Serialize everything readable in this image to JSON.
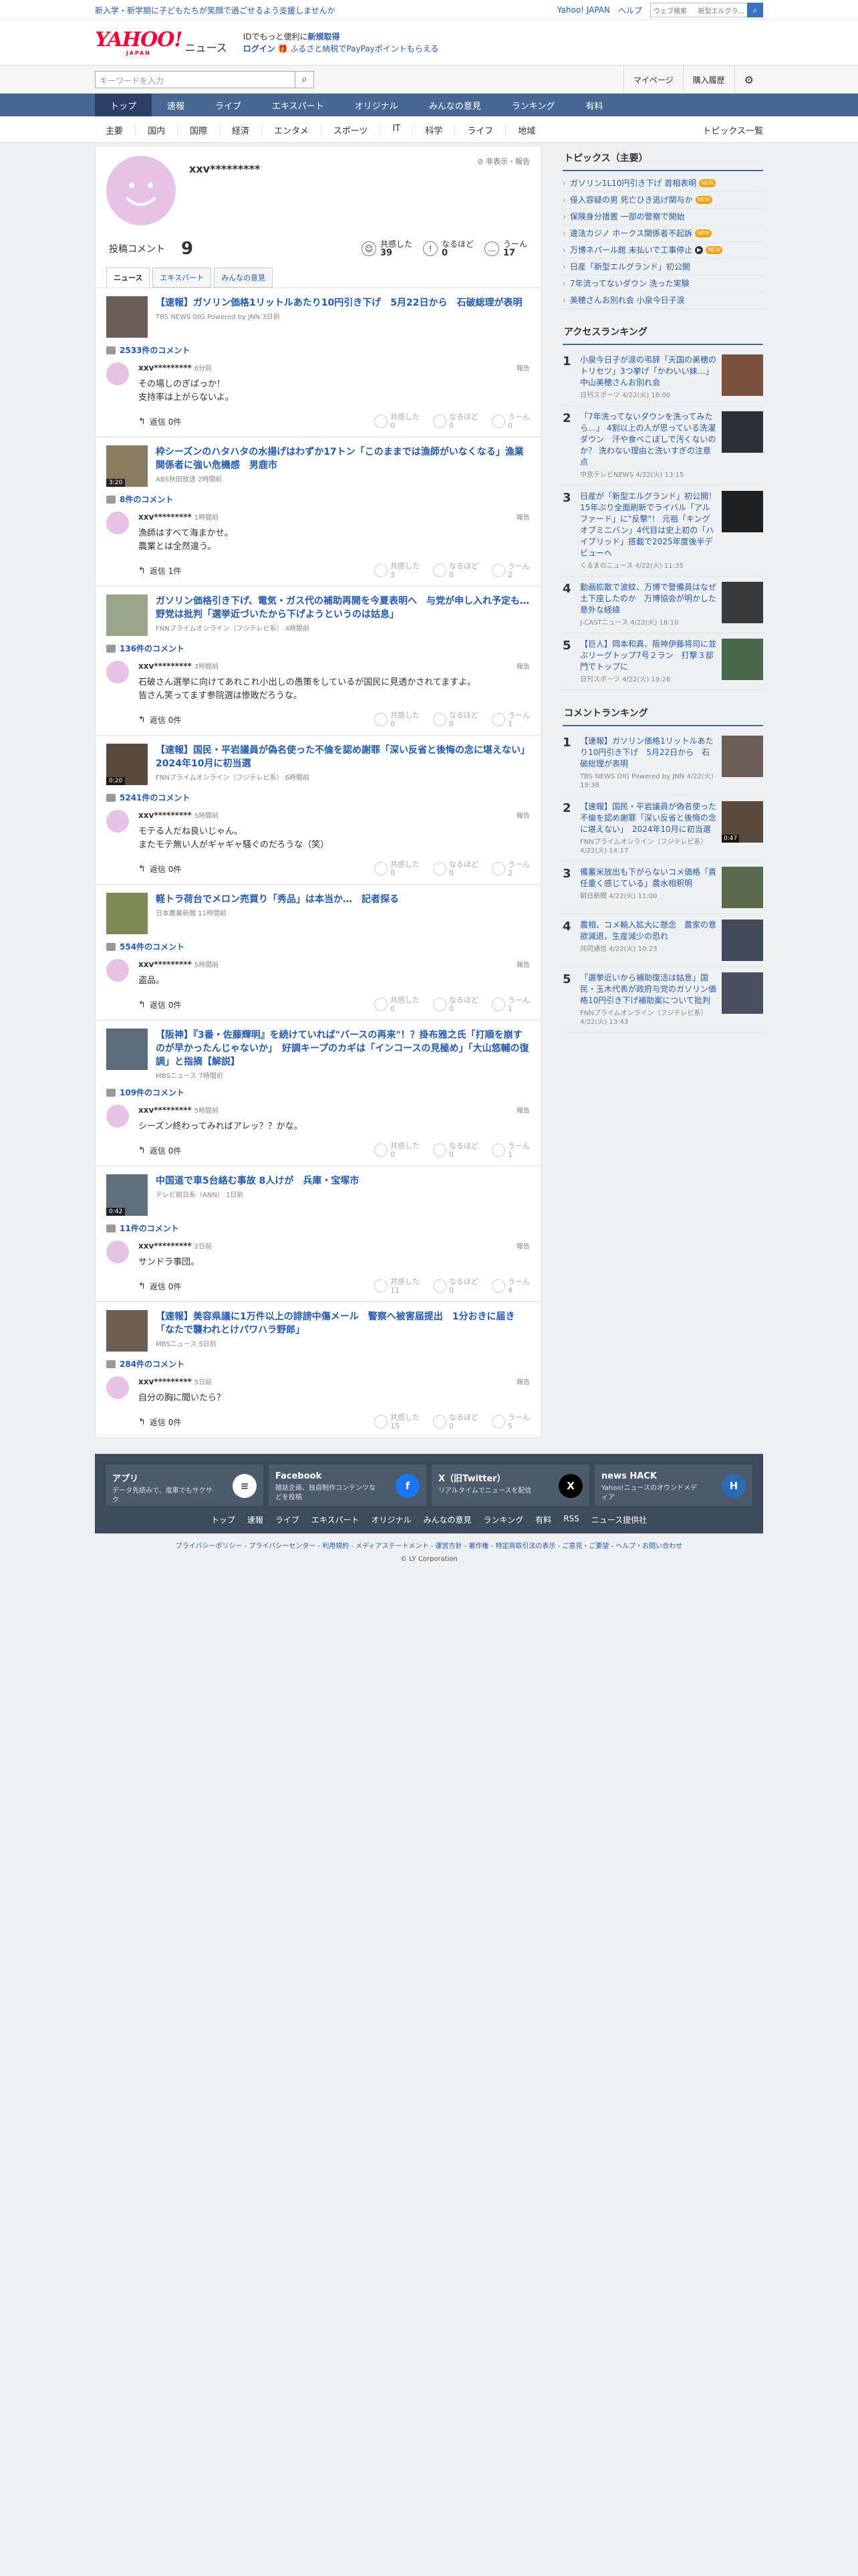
{
  "utility": {
    "promo": "新入学・新学期に子どもたちが笑顔で過ごせるよう支援しませんか",
    "links": [
      "Yahoo! JAPAN",
      "ヘルプ"
    ],
    "search_text": "ウェブ検索",
    "search_query": "新型エルグラ..."
  },
  "header": {
    "logo_text": "YAHOO!",
    "logo_sub": "JAPAN",
    "logo_service": "ニュース",
    "msg_line1_pre": "IDでもっと便利に",
    "msg_line1_link": "新規取得",
    "msg_line2_link": "ログイン",
    "msg_line2_text": "ふるさと納税でPayPayポイントもらえる"
  },
  "searchbar": {
    "placeholder": "キーワードを入力",
    "mypage": "マイページ",
    "history": "購入履歴"
  },
  "nav": {
    "tabs": [
      "トップ",
      "速報",
      "ライブ",
      "エキスパート",
      "オリジナル",
      "みんなの意見",
      "ランキング",
      "有料"
    ],
    "active_index": 0
  },
  "categories": {
    "items": [
      "主要",
      "国内",
      "国際",
      "経済",
      "エンタメ",
      "スポーツ",
      "IT",
      "科学",
      "ライフ",
      "地域"
    ],
    "all": "トピックス一覧"
  },
  "profile": {
    "name": "xxv*********",
    "report": "非表示・報告",
    "post_label": "投稿コメント",
    "post_count": "9",
    "reacts": [
      {
        "label": "共感した",
        "count": "39",
        "icon": "☺"
      },
      {
        "label": "なるほど",
        "count": "0",
        "icon": "!"
      },
      {
        "label": "うーん",
        "count": "17",
        "icon": "…"
      }
    ],
    "tabs": [
      "ニュース",
      "エキスパート",
      "みんなの意見"
    ]
  },
  "comments": [
    {
      "title": "【速報】ガソリン価格1リットルあたり10円引き下げ　5月22日から　石破総理が表明",
      "source": "TBS NEWS DIG Powered by JNN 3日前",
      "count": "2533件のコメント",
      "video": "",
      "thumb_color": "#6b5e57",
      "user": "xxv*********",
      "time": "6分前",
      "text": "その場しのぎばっか！\n支持率は上がらないよ。",
      "reply": "返信 0件",
      "reacts": [
        {
          "label": "共感した",
          "count": "0"
        },
        {
          "label": "なるほど",
          "count": "0"
        },
        {
          "label": "うーん",
          "count": "0"
        }
      ]
    },
    {
      "title": "枠シーズンのハタハタの水揚げはわずか17トン「このままでは漁師がいなくなる」漁業関係者に強い危機感　男鹿市",
      "source": "ABS秋田放送 2時間前",
      "count": "8件のコメント",
      "video": "3:20",
      "thumb_color": "#8a7b63",
      "user": "xxv*********",
      "time": "1時間前",
      "text": "漁師はすべて海まかせ。\n農業とは全然違う。",
      "reply": "返信 1件",
      "reacts": [
        {
          "label": "共感した",
          "count": "3"
        },
        {
          "label": "なるほど",
          "count": "0"
        },
        {
          "label": "うーん",
          "count": "2"
        }
      ]
    },
    {
      "title": "ガソリン価格引き下げ、電気・ガス代の補助再開を今夏表明へ　与党が申し入れ予定も…　野党は批判「選挙近づいたから下げようというのは姑息」",
      "source": "FNNプライムオンライン（フジテレビ系） 4時間前",
      "count": "136件のコメント",
      "video": "",
      "thumb_color": "#9aa58a",
      "user": "xxv*********",
      "time": "3時間前",
      "text": "石破さん選挙に向けてあれこれ小出しの愚策をしているが国民に見透かされてますよ。\n皆さん笑ってます参院選は惨敗だろうな。",
      "reply": "返信 0件",
      "reacts": [
        {
          "label": "共感した",
          "count": "0"
        },
        {
          "label": "なるほど",
          "count": "0"
        },
        {
          "label": "うーん",
          "count": "1"
        }
      ]
    },
    {
      "title": "【速報】国民・平岩議員が偽名使った不倫を認め謝罪「深い反省と後悔の念に堪えない」　2024年10月に初当選",
      "source": "FNNプライムオンライン（フジテレビ系） 6時間前",
      "count": "5241件のコメント",
      "video": "0:20",
      "thumb_color": "#5a4a3e",
      "user": "xxv*********",
      "time": "5時間前",
      "text": "モテる人だね良いじゃん。\nまたモテ無い人がギャギャ騒ぐのだろうな（笑）",
      "reply": "返信 0件",
      "reacts": [
        {
          "label": "共感した",
          "count": "0"
        },
        {
          "label": "なるほど",
          "count": "0"
        },
        {
          "label": "うーん",
          "count": "2"
        }
      ]
    },
    {
      "title": "軽トラ荷台でメロン売買り「秀品」は本当か…　記者探る",
      "source": "日本農業新聞 11時間前",
      "count": "554件のコメント",
      "video": "",
      "thumb_color": "#7d8a56",
      "user": "xxv*********",
      "time": "5時間前",
      "text": "盗品。",
      "reply": "返信 0件",
      "reacts": [
        {
          "label": "共感した",
          "count": "0"
        },
        {
          "label": "なるほど",
          "count": "0"
        },
        {
          "label": "うーん",
          "count": "1"
        }
      ]
    },
    {
      "title": "【阪神】『3番・佐藤輝明』を続けていれば\"バースの再来\"！？掛布雅之氏「打順を崩すのが早かったんじゃないか」　好調キープのカギは「インコースの見極め」「大山悠輔の復調」と指摘【解説】",
      "source": "MBSニュース 7時間前",
      "count": "109件のコメント",
      "video": "",
      "thumb_color": "#5c6b7d",
      "user": "xxv*********",
      "time": "5時間前",
      "text": "シーズン終わってみればアレッ？？かな。",
      "reply": "返信 0件",
      "reacts": [
        {
          "label": "共感した",
          "count": "0"
        },
        {
          "label": "なるほど",
          "count": "0"
        },
        {
          "label": "うーん",
          "count": "1"
        }
      ]
    },
    {
      "title": "中国道で車5台絡む事故 8人けが　兵庫・宝塚市",
      "source": "テレビ朝日系（ANN） 1日前",
      "count": "11件のコメント",
      "video": "0:42",
      "thumb_color": "#60707a",
      "user": "xxv*********",
      "time": "2日前",
      "text": "サンドラ事団。",
      "reply": "返信 0件",
      "reacts": [
        {
          "label": "共感した",
          "count": "11"
        },
        {
          "label": "なるほど",
          "count": "0"
        },
        {
          "label": "うーん",
          "count": "4"
        }
      ]
    },
    {
      "title": "【速報】美容県議に1万件以上の誹謗中傷メール　警察へ被害届提出　1分おきに届き「なたで襲われとけパワハラ野郎」",
      "source": "MBSニュース 5日前",
      "count": "284件のコメント",
      "video": "",
      "thumb_color": "#6e5f52",
      "user": "xxv*********",
      "time": "5日前",
      "text": "自分の胸に聞いたら？",
      "reply": "返信 0件",
      "reacts": [
        {
          "label": "共感した",
          "count": "15"
        },
        {
          "label": "なるほど",
          "count": "0"
        },
        {
          "label": "うーん",
          "count": "5"
        }
      ]
    }
  ],
  "topics": {
    "title": "トピックス（主要）",
    "items": [
      {
        "text": "ガソリン1L10円引き下げ 首相表明",
        "badge": "NEW"
      },
      {
        "text": "侵入容疑の男 死亡ひき逃げ関与か",
        "badge": "NEW"
      },
      {
        "text": "保険身分措置 一部の警察で開始",
        "badge": ""
      },
      {
        "text": "違法カジノ ホークス関係者不起訴",
        "badge": "NEW"
      },
      {
        "text": "万博ネパール館 未払いで工事停止",
        "badge": "NEW",
        "video": true
      },
      {
        "text": "日産「新型エルグランド」初公開",
        "badge": ""
      },
      {
        "text": "7年流ってないダウン 洗った実験",
        "badge": ""
      },
      {
        "text": "美穂さんお別れ会 小泉今日子涙",
        "badge": ""
      }
    ]
  },
  "access_ranking": {
    "title": "アクセスランキング",
    "items": [
      {
        "n": "1",
        "t": "小泉今日子が涙の弔辞「天国の美穂のトリセツ」3つ挙げ「かわいい妹…」中山美穂さんお別れ会",
        "s": "日刊スポーツ 4/22(火) 18:00",
        "color": "#7a5040",
        "video": ""
      },
      {
        "n": "2",
        "t": "「7年洗ってないダウンを洗ってみたら…」 4割以上の人が思っている洗濯ダウン　汗や食べこぼしで汚くないのか？ 洗わない理由と洗いすぎの注意点",
        "s": "中京テレビNEWS 4/22(火) 13:15",
        "color": "#303038",
        "video": ""
      },
      {
        "n": "3",
        "t": "日産が「新型エルグランド」初公開！ 15年ぶり全面刷新でライバル「アルファード」に\"反撃\"！ 元祖「キングオブミニバン」4代目は史上初の「ハイブリッド」搭載で2025年度後半デビューへ",
        "s": "くるまのニュース 4/22(火) 11:35",
        "color": "#202020",
        "video": ""
      },
      {
        "n": "4",
        "t": "動画拡散で波紋、万博で警備員はなぜ土下座したのか　万博協会が明かした意外な経緯",
        "s": "J-CASTニュース 4/22(火) 18:10",
        "color": "#3a3a3a",
        "video": ""
      },
      {
        "n": "5",
        "t": "【巨人】岡本和真、阪神伊藤将司に並ぶリーグトップ7号２ラン　打撃３部門でトップに",
        "s": "日刊スポーツ 4/22(火) 19:26",
        "color": "#4a6a50",
        "video": ""
      }
    ]
  },
  "comment_ranking": {
    "title": "コメントランキング",
    "items": [
      {
        "n": "1",
        "t": "【速報】ガソリン価格1リットルあたり10円引き下げ　5月22日から　石破総理が表明",
        "s": "TBS NEWS DIG Powered by JNN 4/22(火) 19:38",
        "color": "#6b5e57",
        "video": ""
      },
      {
        "n": "2",
        "t": "【速報】国民・平岩議員が偽名使った不倫を認め謝罪「深い反省と後悔の念に堪えない」　2024年10月に初当選",
        "s": "FNNプライムオンライン（フジテレビ系） 4/22(火) 14:17",
        "color": "#5a4a3e",
        "video": "0:47"
      },
      {
        "n": "3",
        "t": "備蓄米放出も下がらないコメ価格「責任重く感じている」農水相釈明",
        "s": "朝日新聞 4/22(火) 11:00",
        "color": "#5a6a4a",
        "video": ""
      },
      {
        "n": "4",
        "t": "農相、コメ輸入拡大に懸念　農家の意欲減退、生産減少の恐れ",
        "s": "共同通信 4/22(火) 10:23",
        "color": "#404a58",
        "video": ""
      },
      {
        "n": "5",
        "t": "「選挙近いから補助復活は姑息」国民・玉木代表が政府与党のガソリン価格10円引き下げ補助案について批判",
        "s": "FNNプライムオンライン（フジテレビ系） 4/22(火) 13:43",
        "color": "#4a5060",
        "video": ""
      }
    ]
  },
  "footer": {
    "cards": [
      {
        "title": "アプリ",
        "desc": "データ先読みで、電車でもサクサク",
        "icon": "≡",
        "icon_bg": "#ffffff",
        "icon_fg": "#3d4a5c"
      },
      {
        "title": "Facebook",
        "desc": "雑誌企画、独自制作コンテンツなどを投稿",
        "icon": "f",
        "icon_bg": "#1877f2",
        "icon_fg": "#ffffff"
      },
      {
        "title": "X（旧Twitter）",
        "desc": "リアルタイムでニュースを配信",
        "icon": "X",
        "icon_bg": "#000000",
        "icon_fg": "#ffffff"
      },
      {
        "title": "news HACK",
        "desc": "Yahoo!ニュースのオウンドメディア",
        "icon": "H",
        "icon_bg": "#2a6ab5",
        "icon_fg": "#ffffff"
      }
    ],
    "links": [
      "トップ",
      "速報",
      "ライブ",
      "エキスパート",
      "オリジナル",
      "みんなの意見",
      "ランキング",
      "有料",
      "RSS",
      "ニュース提供社"
    ],
    "legal": "プライバシーポリシー - プライバシーセンター - 利用規約 - メディアステートメント - 運営方針 - 著作権 - 特定商取引法の表示 - ご意見・ご要望 - ヘルプ・お問い合わせ",
    "copyright": "© LY Corporation"
  }
}
